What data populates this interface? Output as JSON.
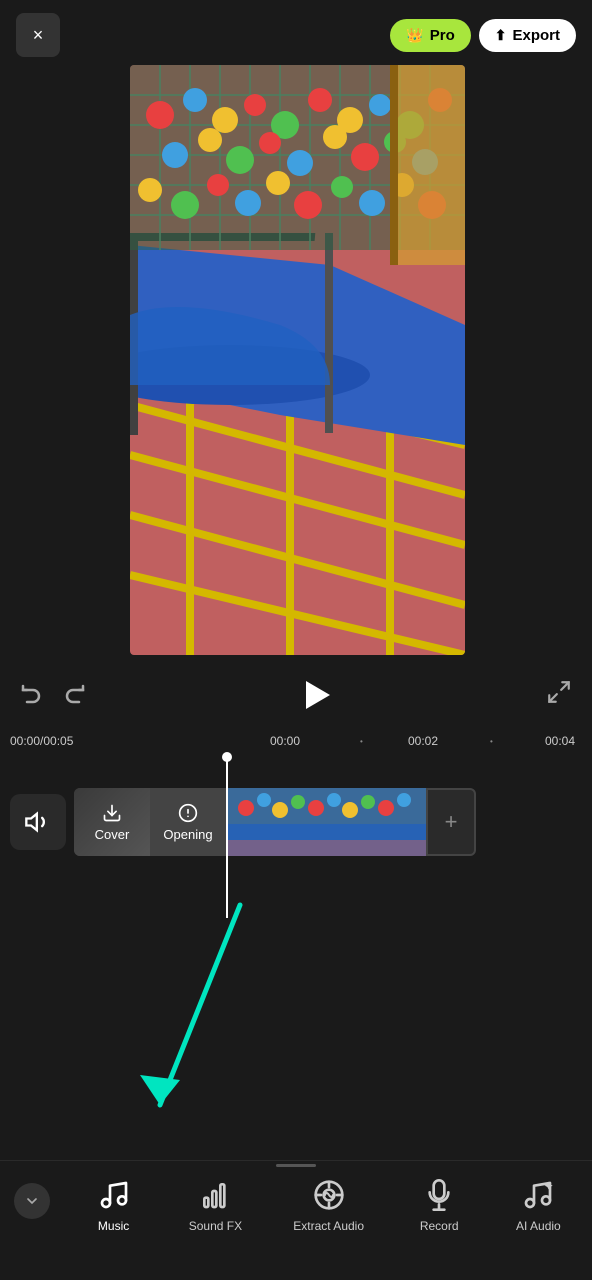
{
  "header": {
    "close_label": "×",
    "pro_label": "Pro",
    "export_label": "Export"
  },
  "timeline": {
    "current_time": "00:00",
    "total_time": "00:05",
    "marker_00": "00:00",
    "marker_02": "00:02",
    "marker_04": "00:04"
  },
  "tracks": {
    "cover_label": "Cover",
    "opening_label": "Opening",
    "add_clip_label": "+"
  },
  "toolbar": {
    "collapse_label": "∨",
    "items": [
      {
        "id": "music",
        "label": "Music",
        "active": true
      },
      {
        "id": "sound-fx",
        "label": "Sound FX",
        "active": false
      },
      {
        "id": "extract-audio",
        "label": "Extract Audio",
        "active": false
      },
      {
        "id": "record",
        "label": "Record",
        "active": false
      },
      {
        "id": "ai-audio",
        "label": "AI Audio",
        "active": false
      }
    ]
  },
  "colors": {
    "accent_green": "#a8e63d",
    "arrow_teal": "#00e5c0",
    "playhead_white": "#ffffff",
    "bg_dark": "#1a1a1a"
  }
}
